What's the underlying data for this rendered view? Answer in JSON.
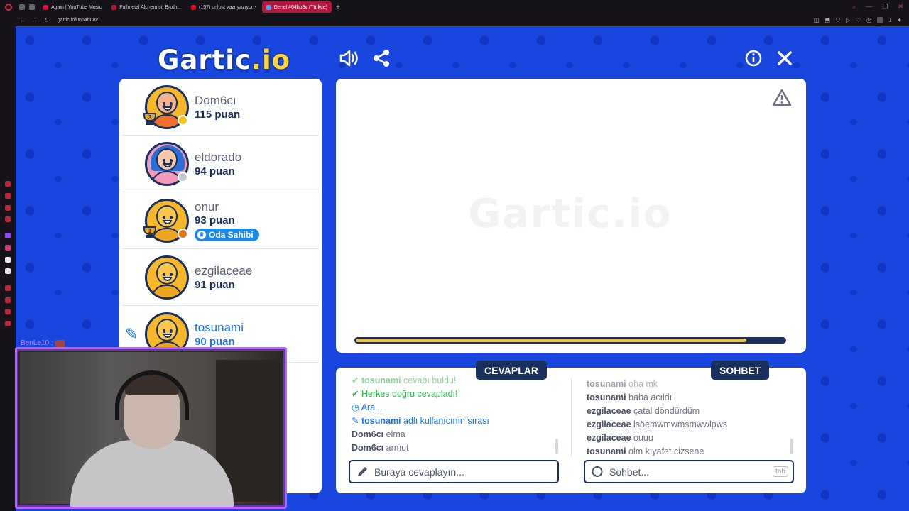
{
  "browser": {
    "tabs": [
      {
        "label": "Again | YouTube Music",
        "color": "#ff0033"
      },
      {
        "label": "Fullmetal Alchemist: Broth...",
        "color": "#c8102e"
      },
      {
        "label": "(157) unlost yazı yazıyor -",
        "color": "#ff0000"
      },
      {
        "label": "Genel #64hu8v (Türkçe)",
        "color": "#3fa9f5",
        "active": true
      }
    ],
    "url": "gartic.io/0664hu8v"
  },
  "game": {
    "logo": "Gartic",
    "logo_suffix": ".io",
    "players": [
      {
        "name": "Dom6cı",
        "score": "115 puan",
        "rank": "3",
        "status_color": "#f4c21a",
        "avatar": "bald"
      },
      {
        "name": "eldorado",
        "score": "94 puan",
        "rank": "",
        "status_color": "#c5c7cc",
        "avatar": "pink"
      },
      {
        "name": "onur",
        "score": "93 puan",
        "rank": "1",
        "status_color": "#e2761b",
        "avatar": "default",
        "badge": "Oda Sahibi"
      },
      {
        "name": "ezgilaceae",
        "score": "91 puan",
        "rank": "",
        "status_color": "",
        "avatar": "default"
      },
      {
        "name": "tosunami",
        "score": "90 puan",
        "rank": "",
        "status_color": "",
        "avatar": "default",
        "drawing": true
      }
    ],
    "watermark": "Gartic.io",
    "timer_progress": 0.91,
    "answers": {
      "title": "CEVAPLAR",
      "lines": [
        {
          "user": "tosunami",
          "text": "cevabı buldu!",
          "type": "green"
        },
        {
          "user": "",
          "text": "Herkes doğru cevapladı!",
          "type": "green"
        },
        {
          "user": "",
          "text": "Ara...",
          "type": "blue"
        },
        {
          "user": "tosunami",
          "text": "adlı kullanıcının sırası",
          "type": "blue"
        },
        {
          "user": "Dom6cı",
          "text": "elma",
          "type": "normal"
        },
        {
          "user": "Dom6cı",
          "text": "armut",
          "type": "normal"
        }
      ],
      "placeholder": "Buraya cevaplayın..."
    },
    "chat": {
      "title": "SOHBET",
      "lines": [
        {
          "user": "tosunami",
          "text": "oha mk"
        },
        {
          "user": "tosunami",
          "text": "baba acıldı"
        },
        {
          "user": "ezgilaceae",
          "text": "çatal döndürdüm"
        },
        {
          "user": "ezgilaceae",
          "text": "lsöemwmwmsmwwlpws"
        },
        {
          "user": "ezgilaceae",
          "text": "ouuu"
        },
        {
          "user": "tosunami",
          "text": "olm kıyafet cizsene"
        }
      ],
      "placeholder": "Sohbet...",
      "tab_hint": "tab"
    }
  },
  "stream": {
    "chat_user": "BenLe10 :"
  }
}
